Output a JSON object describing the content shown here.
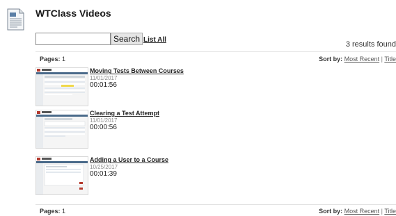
{
  "page": {
    "title": "WTClass Videos",
    "icon": "document-page-icon"
  },
  "search": {
    "value": "",
    "placeholder": "",
    "button_label": "Search",
    "list_all_label": "List All"
  },
  "results": {
    "count_text": "3 results found"
  },
  "pager": {
    "pages_label": "Pages:",
    "current_page": "1",
    "sort_label": "Sort by:",
    "sort_options": [
      "Most Recent",
      "Title"
    ],
    "separator": "|"
  },
  "videos": [
    {
      "title": "Moving Tests Between Courses",
      "date": "11/01/2017",
      "duration": "00:01:56"
    },
    {
      "title": "Clearing a Test Attempt",
      "date": "11/01/2017",
      "duration": "00:00:56"
    },
    {
      "title": "Adding a User to a Course",
      "date": "10/25/2017",
      "duration": "00:01:39"
    }
  ],
  "colors": {
    "accent": "#c0392b",
    "link": "#555555",
    "muted": "#8a8a8a"
  }
}
